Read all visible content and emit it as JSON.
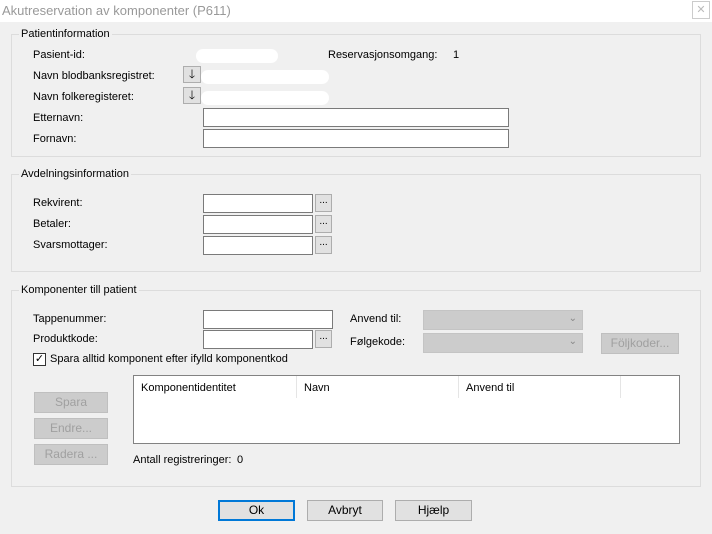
{
  "window": {
    "title": "Akutreservation av komponenter (P611)",
    "close_glyph": "✕"
  },
  "patient": {
    "legend": "Patientinformation",
    "pasient_id_label": "Pasient-id:",
    "reservation_label": "Reservasjonsomgang:",
    "reservation_value": "1",
    "blodbank_label": "Navn blodbanksregistret:",
    "folkereg_label": "Navn folkeregisteret:",
    "etternavn_label": "Etternavn:",
    "fornavn_label": "Fornavn:",
    "arrow_glyph": "🡓"
  },
  "department": {
    "legend": "Avdelningsinformation",
    "rekvirent_label": "Rekvirent:",
    "betaler_label": "Betaler:",
    "svarsmottager_label": "Svarsmottager:",
    "dots": "..."
  },
  "components": {
    "legend": "Komponenter till patient",
    "tappenummer_label": "Tappenummer:",
    "produktkode_label": "Produktkode:",
    "anvend_label": "Anvend til:",
    "folgekode_label": "Følgekode:",
    "foljkoder_button": "Följkoder...",
    "checkbox_label": "Spara alltid komponent efter ifylld komponentkod",
    "checkbox_checked": true,
    "check_glyph": "✓",
    "columns": [
      "Komponentidentitet",
      "Navn",
      "Anvend til"
    ],
    "spara_button": "Spara",
    "endre_button": "Endre...",
    "radera_button": "Radera ...",
    "count_label": "Antall registreringer:",
    "count_value": "0",
    "chevron": "⌄"
  },
  "footer": {
    "ok": "Ok",
    "avbryt": "Avbryt",
    "hjaelp": "Hjælp"
  }
}
